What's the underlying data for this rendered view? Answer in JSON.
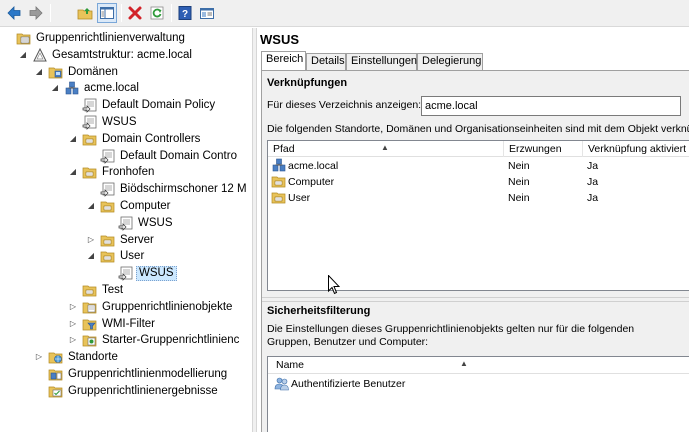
{
  "toolbar": {
    "buttons": [
      "back-icon",
      "forward-icon",
      "up-folder-icon",
      "show-hide-console-tree-icon",
      "delete-icon",
      "refresh-icon",
      "help-icon",
      "properties-icon"
    ]
  },
  "tree": {
    "items": [
      {
        "label": "Gruppenrichtlinienverwaltung",
        "icon": "gpm-icon",
        "level": 0,
        "expander": ""
      },
      {
        "label": "Gesamtstruktur: acme.local",
        "icon": "forest-icon",
        "level": 1,
        "expander": "open"
      },
      {
        "label": "Domänen",
        "icon": "domains-folder-icon",
        "level": 2,
        "expander": "open"
      },
      {
        "label": "acme.local",
        "icon": "domain-icon",
        "level": 3,
        "expander": "open"
      },
      {
        "label": "Default Domain Policy",
        "icon": "gpo-link-icon",
        "level": 4,
        "expander": ""
      },
      {
        "label": "WSUS",
        "icon": "gpo-link-icon",
        "level": 4,
        "expander": ""
      },
      {
        "label": "Domain Controllers",
        "icon": "ou-folder-icon",
        "level": 4,
        "expander": "open"
      },
      {
        "label": "Default Domain Contro",
        "icon": "gpo-link-icon",
        "level": 5,
        "expander": ""
      },
      {
        "label": "Fronhofen",
        "icon": "ou-folder-icon",
        "level": 4,
        "expander": "open"
      },
      {
        "label": "Biödschirmschoner 12 M",
        "icon": "gpo-link-icon",
        "level": 5,
        "expander": ""
      },
      {
        "label": "Computer",
        "icon": "ou-folder-icon",
        "level": 5,
        "expander": "open"
      },
      {
        "label": "WSUS",
        "icon": "gpo-link-icon",
        "level": 6,
        "expander": ""
      },
      {
        "label": "Server",
        "icon": "ou-folder-icon",
        "level": 5,
        "expander": "closed"
      },
      {
        "label": "User",
        "icon": "ou-folder-icon",
        "level": 5,
        "expander": "open"
      },
      {
        "label": "WSUS",
        "icon": "gpo-link-icon",
        "level": 6,
        "expander": "",
        "selected": true
      },
      {
        "label": "Test",
        "icon": "ou-folder-icon",
        "level": 4,
        "expander": ""
      },
      {
        "label": "Gruppenrichtlinienobjekte",
        "icon": "gpo-container-icon",
        "level": 4,
        "expander": "closed"
      },
      {
        "label": "WMI-Filter",
        "icon": "wmi-filter-icon",
        "level": 4,
        "expander": "closed"
      },
      {
        "label": "Starter-Gruppenrichtlinienc",
        "icon": "starter-gpo-icon",
        "level": 4,
        "expander": "closed"
      },
      {
        "label": "Standorte",
        "icon": "sites-icon",
        "level": 2,
        "expander": "closed"
      },
      {
        "label": "Gruppenrichtlinienmodellierung",
        "icon": "gp-modeling-icon",
        "level": 2,
        "expander": ""
      },
      {
        "label": "Gruppenrichtlinienergebnisse",
        "icon": "gp-results-icon",
        "level": 2,
        "expander": ""
      }
    ]
  },
  "details": {
    "title": "WSUS",
    "tabs": [
      {
        "label": "Bereich",
        "active": true
      },
      {
        "label": "Details",
        "active": false
      },
      {
        "label": "Einstellungen",
        "active": false
      },
      {
        "label": "Delegierung",
        "active": false
      }
    ],
    "links": {
      "heading": "Verknüpfungen",
      "location_label": "Für dieses Verzeichnis anzeigen:",
      "location_value": "acme.local",
      "description": "Die folgenden Standorte, Domänen und Organisationseinheiten sind mit dem Objekt verknüpft:",
      "columns": [
        "Pfad",
        "Erzwungen",
        "Verknüpfung aktiviert"
      ],
      "rows": [
        {
          "path": "acme.local",
          "icon": "domain-icon",
          "enforced": "Nein",
          "enabled": "Ja"
        },
        {
          "path": "Computer",
          "icon": "ou-folder-icon",
          "enforced": "Nein",
          "enabled": "Ja"
        },
        {
          "path": "User",
          "icon": "ou-folder-icon",
          "enforced": "Nein",
          "enabled": "Ja"
        }
      ]
    },
    "security": {
      "heading": "Sicherheitsfilterung",
      "description_line1": "Die Einstellungen dieses Gruppenrichtlinienobjekts gelten nur für die folgenden",
      "description_line2": "Gruppen, Benutzer und Computer:",
      "column": "Name",
      "rows": [
        {
          "name": "Authentifizierte Benutzer",
          "icon": "user-group-icon"
        }
      ]
    }
  }
}
